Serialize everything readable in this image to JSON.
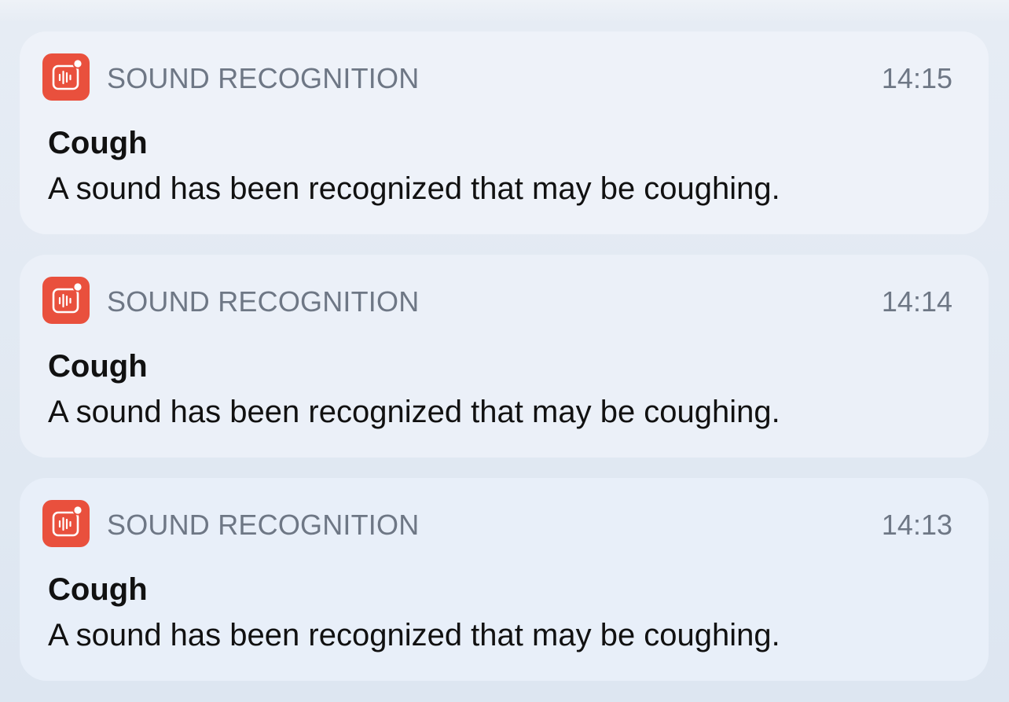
{
  "notifications": [
    {
      "app_name": "SOUND RECOGNITION",
      "icon": "sound-recognition-icon",
      "time": "14:15",
      "title": "Cough",
      "body": "A sound has been recognized that may be coughing."
    },
    {
      "app_name": "SOUND RECOGNITION",
      "icon": "sound-recognition-icon",
      "time": "14:14",
      "title": "Cough",
      "body": "A sound has been recognized that may be coughing."
    },
    {
      "app_name": "SOUND RECOGNITION",
      "icon": "sound-recognition-icon",
      "time": "14:13",
      "title": "Cough",
      "body": "A sound has been recognized that may be coughing."
    }
  ],
  "colors": {
    "icon_background": "#e9503d",
    "app_name_text": "#6e7785",
    "primary_text": "#111111"
  }
}
